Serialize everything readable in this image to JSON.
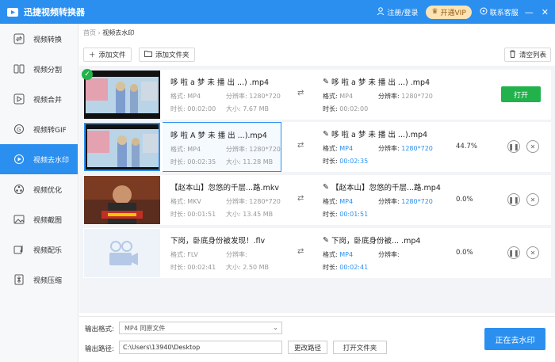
{
  "app": {
    "title": "迅捷视频转换器",
    "login": "注册/登录",
    "vip": "开通VIP",
    "service": "联系客服",
    "minimize": "—",
    "close": "✕"
  },
  "sidebar": {
    "items": [
      {
        "label": "视频转换",
        "icon": "convert-icon"
      },
      {
        "label": "视频分割",
        "icon": "split-icon"
      },
      {
        "label": "视频合并",
        "icon": "merge-icon"
      },
      {
        "label": "视频转GIF",
        "icon": "gif-icon"
      },
      {
        "label": "视频去水印",
        "icon": "watermark-icon"
      },
      {
        "label": "视频优化",
        "icon": "optimize-icon"
      },
      {
        "label": "视频截图",
        "icon": "screenshot-icon"
      },
      {
        "label": "视频配乐",
        "icon": "music-icon"
      },
      {
        "label": "视频压缩",
        "icon": "compress-icon"
      }
    ],
    "active_index": 4
  },
  "breadcrumb": {
    "home": "首页",
    "sep": " › ",
    "current": "视频去水印"
  },
  "toolbar": {
    "add_file": "添加文件",
    "add_folder": "添加文件夹",
    "clear": "清空列表"
  },
  "labels": {
    "format": "格式:",
    "resolution": "分辨率:",
    "duration": "时长:",
    "size": "大小:"
  },
  "files": [
    {
      "name": "哆 啦 a 梦 未 播 出 ...) .mp4",
      "format": "MP4",
      "resolution": "1280*720",
      "duration": "00:02:00",
      "size": "7.67 MB",
      "out_name": "哆 啦 a 梦 未 播 出 ...) .mp4",
      "out_format": "MP4",
      "out_resolution": "1280*720",
      "out_duration": "00:02:00",
      "progress": "",
      "action": "打开"
    },
    {
      "name": "哆 啦 A 梦 未 播 出 ...).mp4",
      "format": "MP4",
      "resolution": "1280*720",
      "duration": "00:02:35",
      "size": "11.28 MB",
      "out_name": "哆 啦 a 梦 未 播 出 ...).mp4",
      "out_format": "MP4",
      "out_resolution": "1280*720",
      "out_duration": "00:02:35",
      "progress": "44.7%",
      "action": ""
    },
    {
      "name": "【赵本山】忽悠的千层...路.mkv",
      "format": "MKV",
      "resolution": "1280*720",
      "duration": "00:01:51",
      "size": "13.45 MB",
      "out_name": "【赵本山】忽悠的千层...路.mp4",
      "out_format": "MP4",
      "out_resolution": "1280*720",
      "out_duration": "00:01:51",
      "progress": "0.0%",
      "action": ""
    },
    {
      "name": "下岗，卧底身份被发现！.flv",
      "format": "FLV",
      "resolution": "",
      "duration": "00:02:41",
      "size": "2.50 MB",
      "out_name": "下岗，卧底身份被... .mp4",
      "out_format": "MP4",
      "out_resolution": "",
      "out_duration": "00:02:41",
      "progress": "0.0%",
      "action": ""
    }
  ],
  "bottom": {
    "format_label": "输出格式:",
    "format_value": "MP4  同原文件",
    "path_label": "输出路径:",
    "path_value": "C:\\Users\\13940\\Desktop",
    "change_path": "更改路径",
    "open_folder": "打开文件夹",
    "start": "正在去水印"
  },
  "colors": {
    "accent": "#2b8ff0",
    "green": "#21b24b",
    "vip_bg": "#fbe3b3"
  }
}
